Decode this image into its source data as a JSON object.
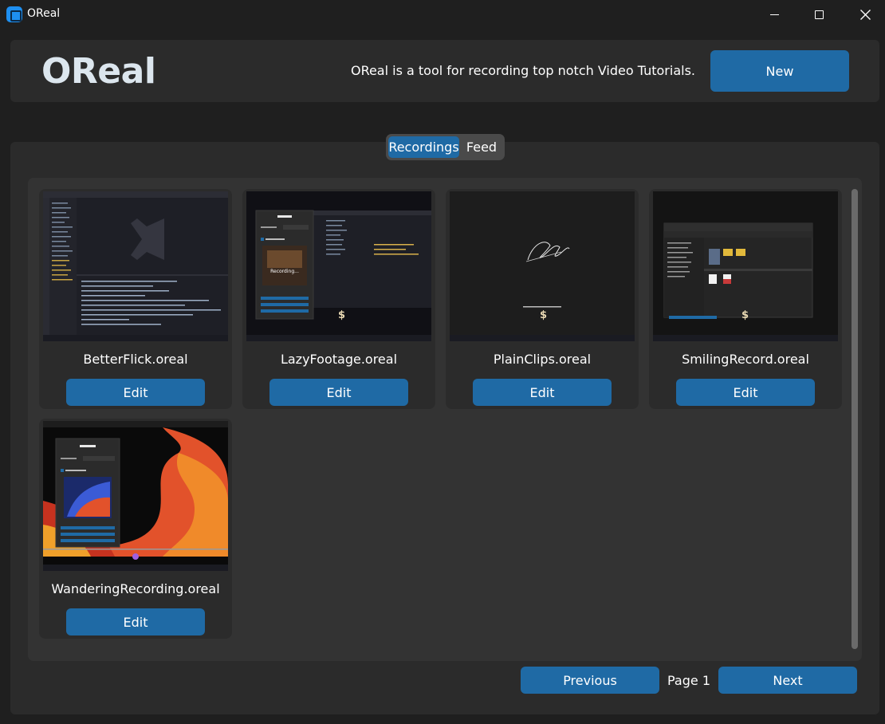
{
  "window": {
    "title": "OReal",
    "icon": "oreal-app-icon",
    "controls": [
      "minimize-icon",
      "maximize-icon",
      "close-icon"
    ]
  },
  "header": {
    "brand": "OReal",
    "tagline": "OReal is a tool for recording top notch Video Tutorials.",
    "new_label": "New"
  },
  "tabs": {
    "recordings": "Recordings",
    "feed": "Feed",
    "active": "Recordings"
  },
  "recordings": [
    {
      "name": "BetterFlick.oreal",
      "edit_label": "Edit",
      "thumbnail": "vscode-editor"
    },
    {
      "name": "LazyFootage.oreal",
      "edit_label": "Edit",
      "thumbnail": "oreal-recording-over-vscode"
    },
    {
      "name": "PlainClips.oreal",
      "edit_label": "Edit",
      "thumbnail": "signature-dark-screen"
    },
    {
      "name": "SmilingRecord.oreal",
      "edit_label": "Edit",
      "thumbnail": "file-explorer"
    },
    {
      "name": "WanderingRecording.oreal",
      "edit_label": "Edit",
      "thumbnail": "media-player-wallpaper"
    }
  ],
  "pagination": {
    "previous_label": "Previous",
    "page_label": "Page 1",
    "next_label": "Next"
  },
  "colors": {
    "accent": "#1f6aa5",
    "background": "#1f1f1f",
    "panel": "#2b2b2b",
    "inner_panel": "#333333"
  }
}
